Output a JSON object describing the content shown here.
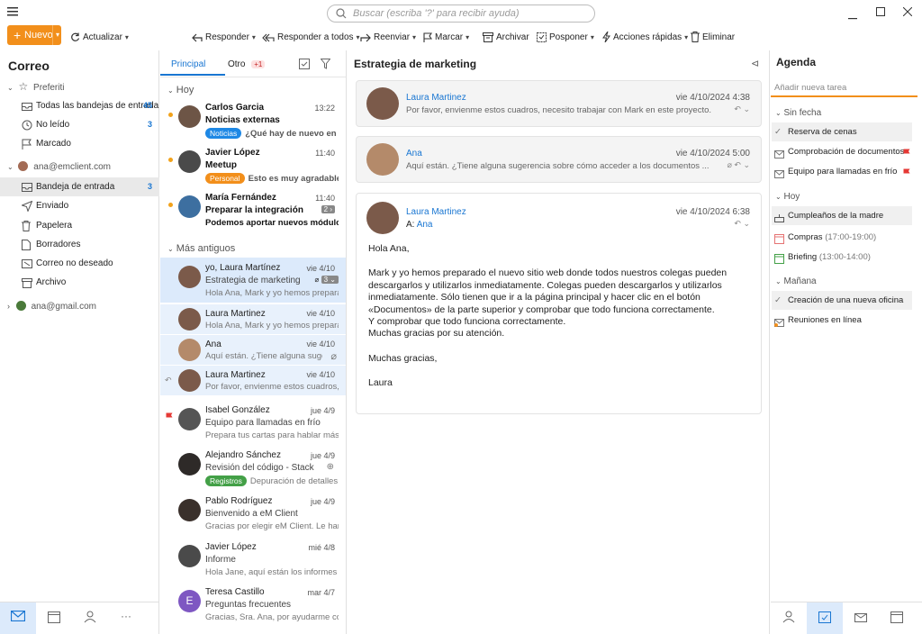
{
  "search": {
    "placeholder": "Buscar (escriba '?' para recibir ayuda)"
  },
  "toolbar": {
    "new_label": "Nuevo",
    "refresh_label": "Actualizar",
    "reply_label": "Responder",
    "reply_all_label": "Responder a todos",
    "forward_label": "Reenviar",
    "mark_label": "Marcar",
    "archive_label": "Archivar",
    "snooze_label": "Posponer",
    "quick_actions_label": "Acciones rápidas",
    "delete_label": "Eliminar"
  },
  "sidebar": {
    "title": "Correo",
    "favorites_label": "Preferiti",
    "favorites": [
      {
        "label": "Todas las bandejas de entrada",
        "count": "45"
      },
      {
        "label": "No leído",
        "count": "3"
      },
      {
        "label": "Marcado",
        "count": ""
      }
    ],
    "account1": "ana@emclient.com",
    "folders": [
      {
        "label": "Bandeja de entrada",
        "count": "3"
      },
      {
        "label": "Enviado",
        "count": ""
      },
      {
        "label": "Papelera",
        "count": ""
      },
      {
        "label": "Borradores",
        "count": ""
      },
      {
        "label": "Correo no deseado",
        "count": ""
      },
      {
        "label": "Archivo",
        "count": ""
      }
    ],
    "account2": "ana@gmail.com"
  },
  "list": {
    "tab_primary": "Principal",
    "tab_other": "Otro",
    "other_badge": "+1",
    "group_today": "Hoy",
    "group_older": "Más antiguos",
    "today": [
      {
        "from": "Carlos Garcia",
        "date": "13:22",
        "subject": "Noticias externas",
        "tag": "Noticias",
        "preview": "¿Qué hay de nuevo en ..."
      },
      {
        "from": "Javier López",
        "date": "11:40",
        "subject": "Meetup",
        "tag": "Personal",
        "preview": "Esto es muy agradable ..."
      },
      {
        "from": "María Fernández",
        "date": "11:40",
        "subject": "Preparar la integración",
        "count": "2",
        "preview": "Podemos aportar nuevos módulos..."
      }
    ],
    "older": [
      {
        "from": "yo, Laura Martínez",
        "date": "vie 4/10",
        "subject": "Estrategia de marketing",
        "count": "3",
        "preview": "Hola Ana, Mark y yo hemos prepara..."
      },
      {
        "from": "Laura Martinez",
        "date": "vie 4/10",
        "subject": "",
        "preview": "Hola Ana, Mark y yo hemos prepara..."
      },
      {
        "from": "Ana",
        "date": "vie 4/10",
        "subject": "",
        "preview": "Aquí están. ¿Tiene alguna suger..."
      },
      {
        "from": "Laura Martinez",
        "date": "vie 4/10",
        "subject": "",
        "preview": "Por favor, envienme estos cuadros, ..."
      },
      {
        "from": "Isabel González",
        "date": "jue 4/9",
        "subject": "Equipo para llamadas en frío",
        "preview": "Prepara tus cartas para hablar más ..."
      },
      {
        "from": "Alejandro Sánchez",
        "date": "jue 4/9",
        "subject": "Revisión del código - Stack",
        "tag": "Registros",
        "preview": "Depuración de detalles. ..."
      },
      {
        "from": "Pablo Rodríguez",
        "date": "jue 4/9",
        "subject": "Bienvenido a eM Client",
        "preview": "Gracias por elegir eM Client. Le hará..."
      },
      {
        "from": "Javier López",
        "date": "mié 4/8",
        "subject": "Informe",
        "preview": "Hola Jane, aquí están los informes q..."
      },
      {
        "from": "Teresa Castillo",
        "date": "mar 4/7",
        "subject": "Preguntas frecuentes",
        "initial": "E",
        "preview": "Gracias, Sra. Ana, por ayudarme con ..."
      }
    ]
  },
  "reader": {
    "title": "Estrategia de marketing",
    "msg1": {
      "from": "Laura Martinez",
      "date": "vie 4/10/2024 4:38",
      "preview": "Por favor, envienme estos cuadros, necesito trabajar con Mark en este proyecto."
    },
    "msg2": {
      "from": "Ana",
      "date": "vie 4/10/2024 5:00",
      "preview": "Aquí están. ¿Tiene alguna sugerencia sobre cómo acceder a los documentos ..."
    },
    "msg3": {
      "from": "Laura Martinez",
      "date": "vie 4/10/2024 6:38",
      "to_label": "A:",
      "to": "Ana",
      "greeting": "Hola Ana,",
      "p1": "Mark y yo hemos preparado el nuevo sitio web donde todos nuestros colegas pueden descargarlos y utilizarlos inmediatamente. Colegas pueden descargarlos y utilizarlos inmediatamente. Sólo tienen que ir a la página principal y hacer clic en el botón «Documentos» de la parte superior y comprobar que todo funciona correctamente.",
      "p1b": "Y comprobar que todo funciona correctamente.",
      "p1c": "Muchas gracias por su atención.",
      "closing": "Muchas gracias,",
      "sign": "Laura"
    }
  },
  "agenda": {
    "title": "Agenda",
    "new_task_placeholder": "Añadir nueva tarea",
    "sec_nodate": "Sin fecha",
    "nodate": [
      {
        "label": "Reserva de cenas",
        "time": ""
      },
      {
        "label": "Comprobación de documentos",
        "time": ""
      },
      {
        "label": "Equipo para llamadas en frío",
        "time": ""
      }
    ],
    "sec_today": "Hoy",
    "today": [
      {
        "label": "Cumpleaños de la madre",
        "time": ""
      },
      {
        "label": "Compras",
        "time": "(17:00-19:00)"
      },
      {
        "label": "Briefing",
        "time": "(13:00-14:00)"
      }
    ],
    "sec_tomorrow": "Mañana",
    "tomorrow": [
      {
        "label": "Creación de una nueva oficina",
        "time": ""
      },
      {
        "label": "Reuniones en línea",
        "time": ""
      }
    ]
  },
  "colors": {
    "accent": "#1976d2",
    "orange": "#f28f1b",
    "tag_news": "#1e88e5",
    "tag_personal": "#f28f1b",
    "tag_logs": "#43a047",
    "flag": "#e53935"
  }
}
